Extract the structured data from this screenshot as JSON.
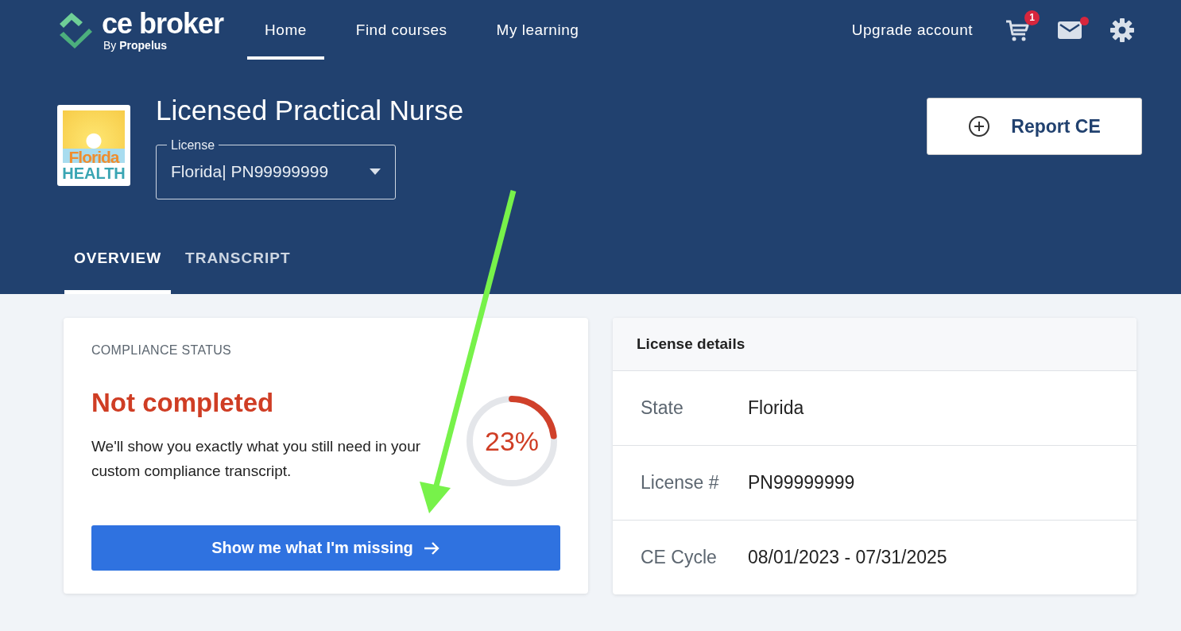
{
  "brand": {
    "name": "ce broker",
    "byline_prefix": "By",
    "byline_brand": "Propelus"
  },
  "nav": [
    {
      "label": "Home",
      "selected": true
    },
    {
      "label": "Find courses",
      "selected": false
    },
    {
      "label": "My learning",
      "selected": false
    }
  ],
  "account_link": "Upgrade account",
  "cart_badge": "1",
  "mail_unread": true,
  "license_logo": {
    "line1": "Florida",
    "line2": "HEALTH"
  },
  "profession": "Licensed Practical Nurse",
  "license_select": {
    "label": "License",
    "value": "Florida| PN99999999"
  },
  "report_button": "Report CE",
  "tabs": [
    {
      "label": "OVERVIEW",
      "selected": true
    },
    {
      "label": "TRANSCRIPT",
      "selected": false
    }
  ],
  "compliance": {
    "heading": "COMPLIANCE STATUS",
    "status": "Not completed",
    "description": "We'll show you exactly what you still need in your custom compliance transcript.",
    "progress": {
      "level": 0.23,
      "reading": "23%"
    },
    "button": "Show me what I'm missing"
  },
  "license_details": {
    "title": "License details",
    "rows": [
      {
        "label": "State",
        "value": "Florida"
      },
      {
        "label": "License #",
        "value": "PN99999999"
      },
      {
        "label": "CE Cycle",
        "value": "08/01/2023 - 07/31/2025"
      }
    ]
  }
}
